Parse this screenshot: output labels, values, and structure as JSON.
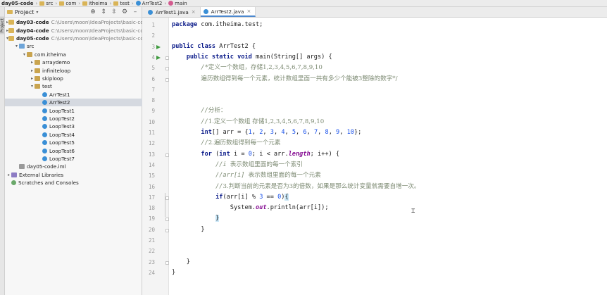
{
  "navbar": {
    "crumbs": [
      {
        "label": "day05-code",
        "icon": "folder-icon"
      },
      {
        "label": "src",
        "icon": "folder-icon"
      },
      {
        "label": "com",
        "icon": "folder-icon"
      },
      {
        "label": "itheima",
        "icon": "folder-icon"
      },
      {
        "label": "test",
        "icon": "folder-icon"
      },
      {
        "label": "ArrTest2",
        "icon": "class-icon"
      },
      {
        "label": "main",
        "icon": "method-icon"
      }
    ]
  },
  "toolstrip": {
    "label": "Project"
  },
  "project": {
    "title": "Project",
    "tree": [
      {
        "label": "day03-code",
        "path": "C:\\Users\\moon\\IdeaProjects\\basic-code",
        "level": 0,
        "arrow": "▸",
        "icon": "folder",
        "bold": true
      },
      {
        "label": "day04-code",
        "path": "C:\\Users\\moon\\IdeaProjects\\basic-code",
        "level": 0,
        "arrow": "▸",
        "icon": "folder",
        "bold": true
      },
      {
        "label": "day05-code",
        "path": "C:\\Users\\moon\\IdeaProjects\\basic-code",
        "level": 0,
        "arrow": "▾",
        "icon": "folder",
        "bold": true
      },
      {
        "label": "src",
        "path": "",
        "level": 1,
        "arrow": "▾",
        "icon": "src",
        "bold": false
      },
      {
        "label": "com.itheima",
        "path": "",
        "level": 2,
        "arrow": "▾",
        "icon": "pkg",
        "bold": false
      },
      {
        "label": "arraydemo",
        "path": "",
        "level": 3,
        "arrow": "▸",
        "icon": "pkg",
        "bold": false
      },
      {
        "label": "infiniteloop",
        "path": "",
        "level": 3,
        "arrow": "▸",
        "icon": "pkg",
        "bold": false
      },
      {
        "label": "skiploop",
        "path": "",
        "level": 3,
        "arrow": "▸",
        "icon": "pkg",
        "bold": false
      },
      {
        "label": "test",
        "path": "",
        "level": 3,
        "arrow": "▾",
        "icon": "pkg",
        "bold": false
      },
      {
        "label": "ArrTest1",
        "path": "",
        "level": 4,
        "arrow": "",
        "icon": "class",
        "bold": false
      },
      {
        "label": "ArrTest2",
        "path": "",
        "level": 4,
        "arrow": "",
        "icon": "class",
        "bold": false,
        "selected": true
      },
      {
        "label": "LoopTest1",
        "path": "",
        "level": 4,
        "arrow": "",
        "icon": "class",
        "bold": false
      },
      {
        "label": "LoopTest2",
        "path": "",
        "level": 4,
        "arrow": "",
        "icon": "class",
        "bold": false
      },
      {
        "label": "LoopTest3",
        "path": "",
        "level": 4,
        "arrow": "",
        "icon": "class",
        "bold": false
      },
      {
        "label": "LoopTest4",
        "path": "",
        "level": 4,
        "arrow": "",
        "icon": "class",
        "bold": false
      },
      {
        "label": "LoopTest5",
        "path": "",
        "level": 4,
        "arrow": "",
        "icon": "class",
        "bold": false
      },
      {
        "label": "LoopTest6",
        "path": "",
        "level": 4,
        "arrow": "",
        "icon": "class",
        "bold": false
      },
      {
        "label": "LoopTest7",
        "path": "",
        "level": 4,
        "arrow": "",
        "icon": "class",
        "bold": false
      },
      {
        "label": "day05-code.iml",
        "path": "",
        "level": 1,
        "arrow": "",
        "icon": "iml",
        "bold": false
      },
      {
        "label": "External Libraries",
        "path": "",
        "level": 0,
        "arrow": "▸",
        "icon": "lib",
        "bold": false
      },
      {
        "label": "Scratches and Consoles",
        "path": "",
        "level": 0,
        "arrow": "",
        "icon": "scratch",
        "bold": false
      }
    ]
  },
  "tabs": [
    {
      "label": "ArrTest1.java",
      "active": false
    },
    {
      "label": "ArrTest2.java",
      "active": true
    }
  ],
  "editor": {
    "line_numbers": [
      "1",
      "2",
      "3",
      "4",
      "5",
      "6",
      "7",
      "8",
      "9",
      "10",
      "11",
      "12",
      "13",
      "14",
      "15",
      "16",
      "17",
      "18",
      "19",
      "20",
      "21",
      "22",
      "23",
      "24"
    ],
    "lines": [
      [
        {
          "t": "package",
          "c": "kw"
        },
        {
          "t": " com.itheima.test;",
          "c": ""
        }
      ],
      [],
      [
        {
          "t": "public class",
          "c": "kw"
        },
        {
          "t": " ArrTest2 {",
          "c": ""
        }
      ],
      [
        {
          "t": "    public static void",
          "c": "kw"
        },
        {
          "t": " main(String[] args) {",
          "c": ""
        }
      ],
      [
        {
          "t": "        /*",
          "c": "cm"
        },
        {
          "t": "定义一个数组，存储1,2,3,4,5,6,7,8,9,10",
          "c": "cm-zh"
        }
      ],
      [
        {
          "t": "        ",
          "c": ""
        },
        {
          "t": "遍历数组得到每一个元素，统计数组里面一共有多少个能被3整除的数字*/",
          "c": "cm-zh"
        }
      ],
      [],
      [],
      [
        {
          "t": "        //",
          "c": "cm"
        },
        {
          "t": "分析：",
          "c": "cm-zh"
        }
      ],
      [
        {
          "t": "        //",
          "c": "cm"
        },
        {
          "t": "1.定义一个数组 存储1,2,3,4,5,6,7,8,9,10",
          "c": "cm-zh"
        }
      ],
      [
        {
          "t": "        int",
          "c": "kw"
        },
        {
          "t": "[] arr = {",
          "c": ""
        },
        {
          "t": "1",
          "c": "num"
        },
        {
          "t": ", ",
          "c": ""
        },
        {
          "t": "2",
          "c": "num"
        },
        {
          "t": ", ",
          "c": ""
        },
        {
          "t": "3",
          "c": "num"
        },
        {
          "t": ", ",
          "c": ""
        },
        {
          "t": "4",
          "c": "num"
        },
        {
          "t": ", ",
          "c": ""
        },
        {
          "t": "5",
          "c": "num"
        },
        {
          "t": ", ",
          "c": ""
        },
        {
          "t": "6",
          "c": "num"
        },
        {
          "t": ", ",
          "c": ""
        },
        {
          "t": "7",
          "c": "num"
        },
        {
          "t": ", ",
          "c": ""
        },
        {
          "t": "8",
          "c": "num"
        },
        {
          "t": ", ",
          "c": ""
        },
        {
          "t": "9",
          "c": "num"
        },
        {
          "t": ", ",
          "c": ""
        },
        {
          "t": "10",
          "c": "num"
        },
        {
          "t": "};",
          "c": ""
        }
      ],
      [
        {
          "t": "        //",
          "c": "cm"
        },
        {
          "t": "2.遍历数组得到每一个元素",
          "c": "cm-zh"
        }
      ],
      [
        {
          "t": "        for",
          "c": "kw"
        },
        {
          "t": " (",
          "c": ""
        },
        {
          "t": "int",
          "c": "kw"
        },
        {
          "t": " i = ",
          "c": ""
        },
        {
          "t": "0",
          "c": "num"
        },
        {
          "t": "; i < arr.",
          "c": ""
        },
        {
          "t": "length",
          "c": "fld"
        },
        {
          "t": "; i++) {",
          "c": ""
        }
      ],
      [
        {
          "t": "            //i ",
          "c": "cm"
        },
        {
          "t": "表示数组里面的每一个索引",
          "c": "cm-zh"
        }
      ],
      [
        {
          "t": "            //arr[i] ",
          "c": "cm"
        },
        {
          "t": "表示数组里面的每一个元素",
          "c": "cm-zh"
        }
      ],
      [
        {
          "t": "            //",
          "c": "cm"
        },
        {
          "t": "3.判断当前的元素是否为3的倍数，如果是那么统计变量就需要自增一次。",
          "c": "cm-zh"
        }
      ],
      [
        {
          "t": "            if",
          "c": "kw"
        },
        {
          "t": "(arr[i] % ",
          "c": ""
        },
        {
          "t": "3",
          "c": "num"
        },
        {
          "t": " == ",
          "c": ""
        },
        {
          "t": "0",
          "c": "num"
        },
        {
          "t": ")",
          "c": ""
        },
        {
          "t": "{",
          "c": "brace-hl"
        }
      ],
      [
        {
          "t": "                System.",
          "c": ""
        },
        {
          "t": "out",
          "c": "fld"
        },
        {
          "t": ".println(arr[i]);",
          "c": ""
        }
      ],
      [
        {
          "t": "            ",
          "c": ""
        },
        {
          "t": "}",
          "c": "brace-hl"
        }
      ],
      [
        {
          "t": "        }",
          "c": ""
        }
      ],
      [],
      [],
      [
        {
          "t": "    }",
          "c": ""
        }
      ],
      [
        {
          "t": "}",
          "c": ""
        }
      ]
    ],
    "run_lines": [
      3,
      4
    ]
  }
}
